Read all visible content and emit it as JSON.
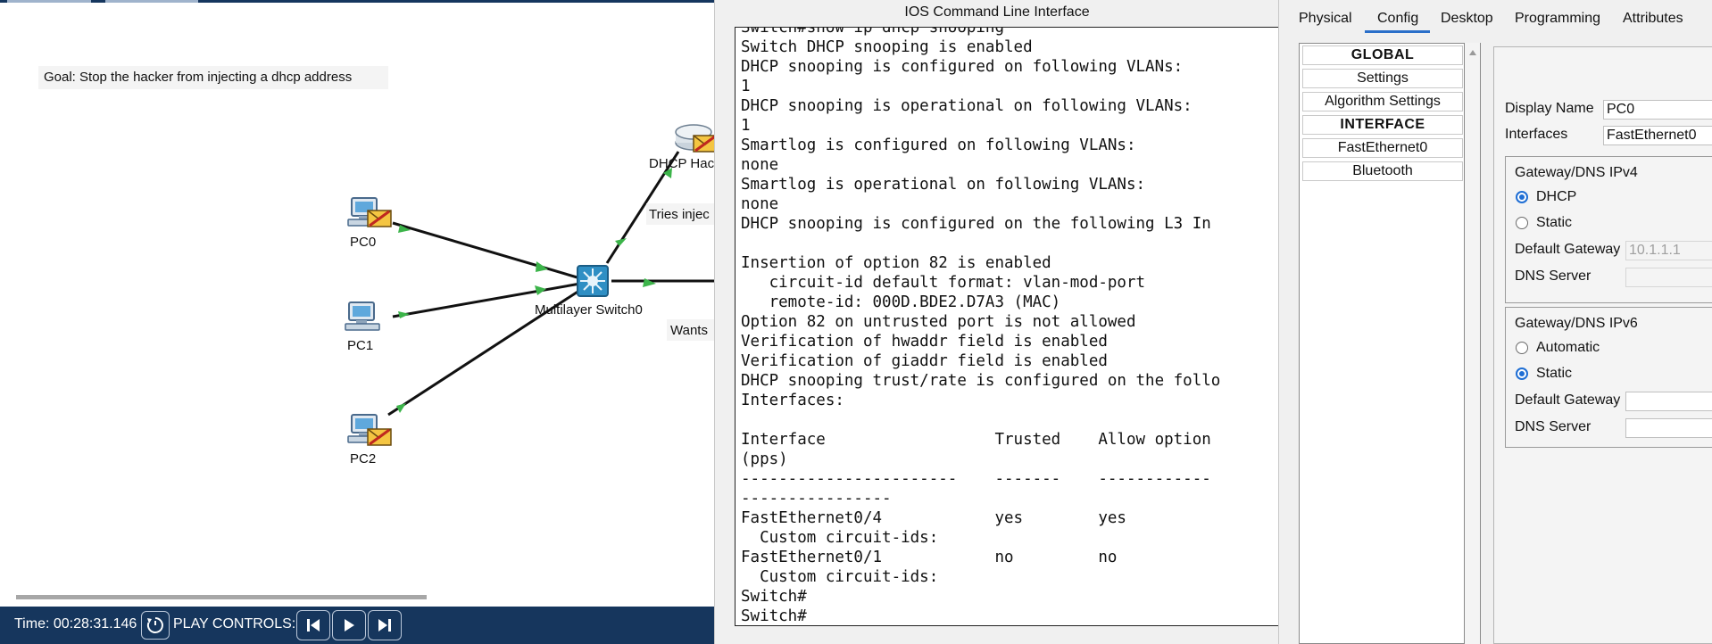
{
  "topology": {
    "goal_note": "Goal: Stop the hacker from injecting a dhcp address",
    "devices": {
      "pc0": "PC0",
      "pc1": "PC1",
      "pc2": "PC2",
      "switch": "Multilayer Switch0",
      "dhcp_hacker": "DHCP Hac"
    },
    "notes": {
      "tries_inject": "Tries injec",
      "wants": "Wants"
    },
    "bottom_bar": {
      "time": "Time: 00:28:31.146",
      "play_controls_label": "PLAY CONTROLS:"
    },
    "icons": [
      "pc-icon",
      "envelope-icon",
      "switch-icon",
      "router-icon",
      "reset-icon",
      "skip-back-icon",
      "play-icon",
      "skip-forward-icon"
    ]
  },
  "cli": {
    "title": "IOS Command Line Interface",
    "lines": [
      "Switch#show ip dhcp snooping",
      "Switch DHCP snooping is enabled",
      "DHCP snooping is configured on following VLANs:",
      "1",
      "DHCP snooping is operational on following VLANs:",
      "1",
      "Smartlog is configured on following VLANs:",
      "none",
      "Smartlog is operational on following VLANs:",
      "none",
      "DHCP snooping is configured on the following L3 In",
      "",
      "Insertion of option 82 is enabled",
      "   circuit-id default format: vlan-mod-port",
      "   remote-id: 000D.BDE2.D7A3 (MAC)",
      "Option 82 on untrusted port is not allowed",
      "Verification of hwaddr field is enabled",
      "Verification of giaddr field is enabled",
      "DHCP snooping trust/rate is configured on the follo",
      "Interfaces:",
      "",
      "Interface                  Trusted    Allow option",
      "(pps)",
      "-----------------------    -------    ------------",
      "----------------",
      "FastEthernet0/4            yes        yes",
      "  Custom circuit-ids:",
      "FastEthernet0/1            no         no",
      "  Custom circuit-ids:",
      "Switch#",
      "Switch#"
    ]
  },
  "config": {
    "tabs": [
      "Physical",
      "Config",
      "Desktop",
      "Programming",
      "Attributes"
    ],
    "active_tab": "Config",
    "sidebar": {
      "global_header": "GLOBAL",
      "settings": "Settings",
      "algorithm_settings": "Algorithm Settings",
      "interface_header": "INTERFACE",
      "fastethernet0": "FastEthernet0",
      "bluetooth": "Bluetooth"
    },
    "form": {
      "display_name_label": "Display Name",
      "display_name_value": "PC0",
      "interfaces_label": "Interfaces",
      "interfaces_value": "FastEthernet0",
      "ipv4": {
        "title": "Gateway/DNS IPv4",
        "dhcp_label": "DHCP",
        "static_label": "Static",
        "selected": "DHCP",
        "gateway_label": "Default Gateway",
        "gateway_value": "10.1.1.1",
        "dns_label": "DNS Server",
        "dns_value": ""
      },
      "ipv6": {
        "title": "Gateway/DNS IPv6",
        "automatic_label": "Automatic",
        "static_label": "Static",
        "selected": "Static",
        "gateway_label": "Default Gateway",
        "gateway_value": "",
        "dns_label": "DNS Server",
        "dns_value": ""
      }
    }
  }
}
